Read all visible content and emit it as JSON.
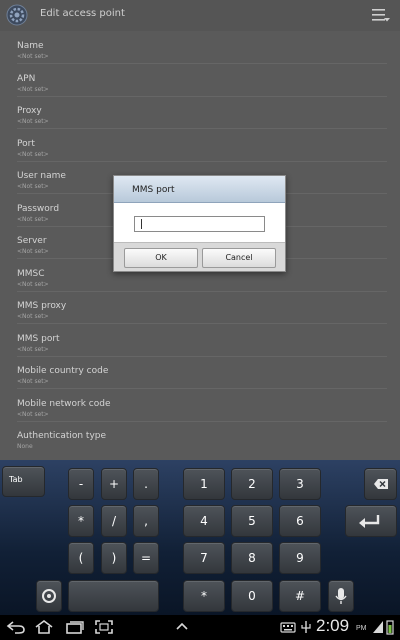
{
  "header": {
    "title": "Edit access point",
    "app_icon": "settings-gear-icon",
    "menu_icon": "menu-icon"
  },
  "preferences": [
    {
      "title": "Name",
      "value": "<Not set>"
    },
    {
      "title": "APN",
      "value": "<Not set>"
    },
    {
      "title": "Proxy",
      "value": "<Not set>"
    },
    {
      "title": "Port",
      "value": "<Not set>"
    },
    {
      "title": "User name",
      "value": "<Not set>"
    },
    {
      "title": "Password",
      "value": "<Not set>"
    },
    {
      "title": "Server",
      "value": "<Not set>"
    },
    {
      "title": "MMSC",
      "value": "<Not set>"
    },
    {
      "title": "MMS proxy",
      "value": "<Not set>"
    },
    {
      "title": "MMS port",
      "value": "<Not set>"
    },
    {
      "title": "Mobile country code",
      "value": "<Not set>"
    },
    {
      "title": "Mobile network code",
      "value": "<Not set>"
    },
    {
      "title": "Authentication type",
      "value": "None"
    }
  ],
  "dialog": {
    "title": "MMS port",
    "input_value": "",
    "ok_label": "OK",
    "cancel_label": "Cancel"
  },
  "keyboard": {
    "tab": "Tab",
    "symbols": [
      "-",
      "+",
      ".",
      "*",
      "/",
      ",",
      "(",
      ")",
      "="
    ],
    "digits": [
      "1",
      "2",
      "3",
      "4",
      "5",
      "6",
      "7",
      "8",
      "9",
      "*",
      "0",
      "#"
    ]
  },
  "status_bar": {
    "time": "2:09",
    "ampm": "PM"
  },
  "colors": {
    "keyboard_top": "#2d4163",
    "keyboard_bottom": "#0a1526",
    "dialog_header": "#c8d6e5",
    "dim_background": "#5a5a5a"
  }
}
